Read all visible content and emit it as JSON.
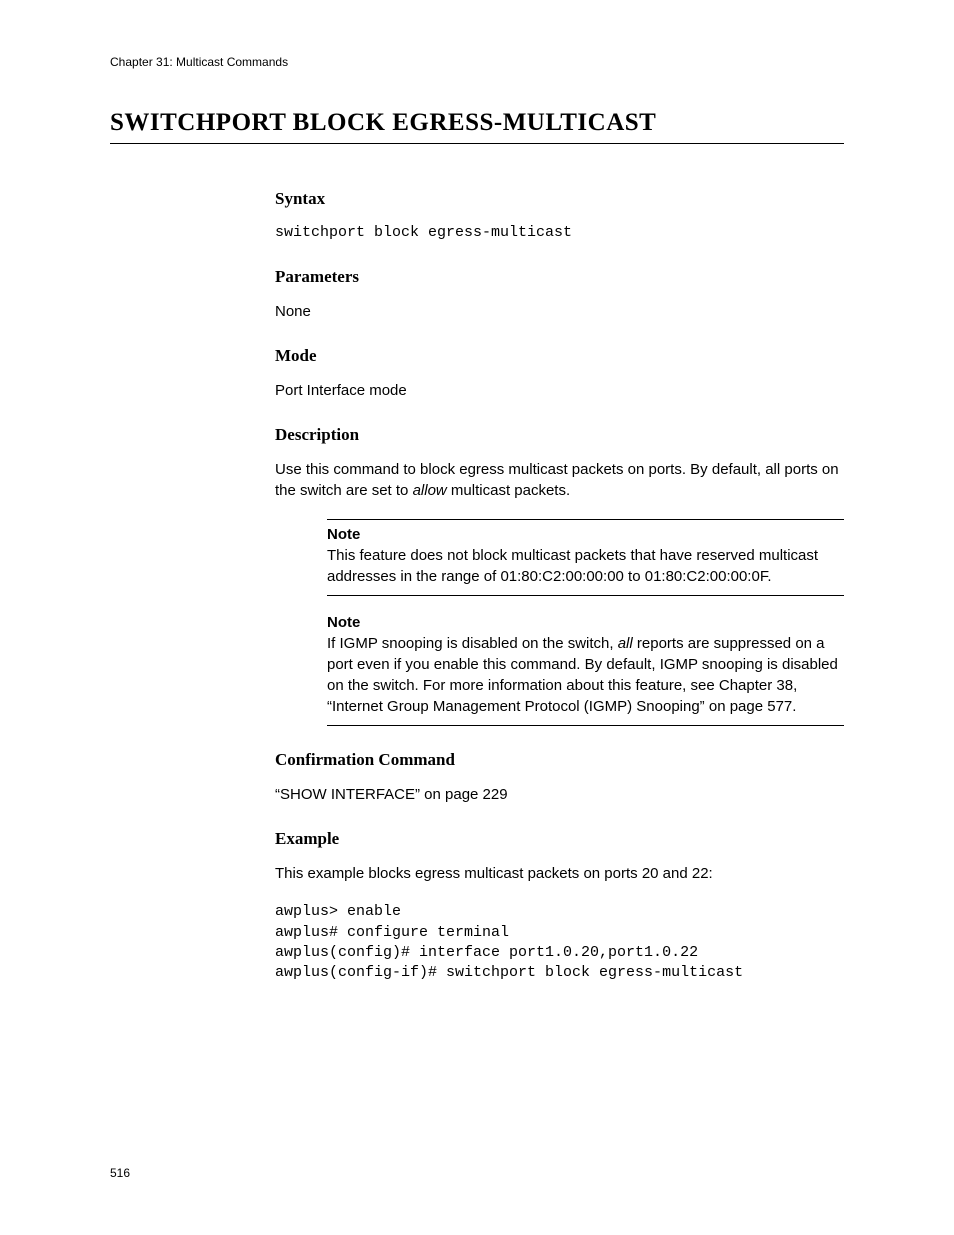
{
  "chapter_header": "Chapter 31: Multicast Commands",
  "title": "SWITCHPORT BLOCK EGRESS-MULTICAST",
  "syntax": {
    "heading": "Syntax",
    "code": "switchport block egress-multicast"
  },
  "parameters": {
    "heading": "Parameters",
    "text": "None"
  },
  "mode": {
    "heading": "Mode",
    "text": "Port Interface mode"
  },
  "description": {
    "heading": "Description",
    "text_before": "Use this command to block egress multicast packets on ports. By default, all ports on the switch are set to ",
    "italic_word": "allow",
    "text_after": " multicast packets."
  },
  "note1": {
    "label": "Note",
    "text": "This feature does not block multicast packets that have reserved multicast addresses in the range of 01:80:C2:00:00:00 to 01:80:C2:00:00:0F."
  },
  "note2": {
    "label": "Note",
    "text_before": "If IGMP snooping is disabled on the switch, ",
    "italic_word": "all",
    "text_after": " reports are suppressed on a port even if you enable this command. By default, IGMP snooping is disabled on the switch. For more information about this feature, see Chapter 38, “Internet Group Management Protocol (IGMP) Snooping” on page 577."
  },
  "confirmation": {
    "heading": "Confirmation Command",
    "text": "“SHOW INTERFACE” on page 229"
  },
  "example": {
    "heading": "Example",
    "intro": "This example blocks egress multicast packets on ports 20 and 22:",
    "code": "awplus> enable\nawplus# configure terminal\nawplus(config)# interface port1.0.20,port1.0.22\nawplus(config-if)# switchport block egress-multicast"
  },
  "page_number": "516"
}
